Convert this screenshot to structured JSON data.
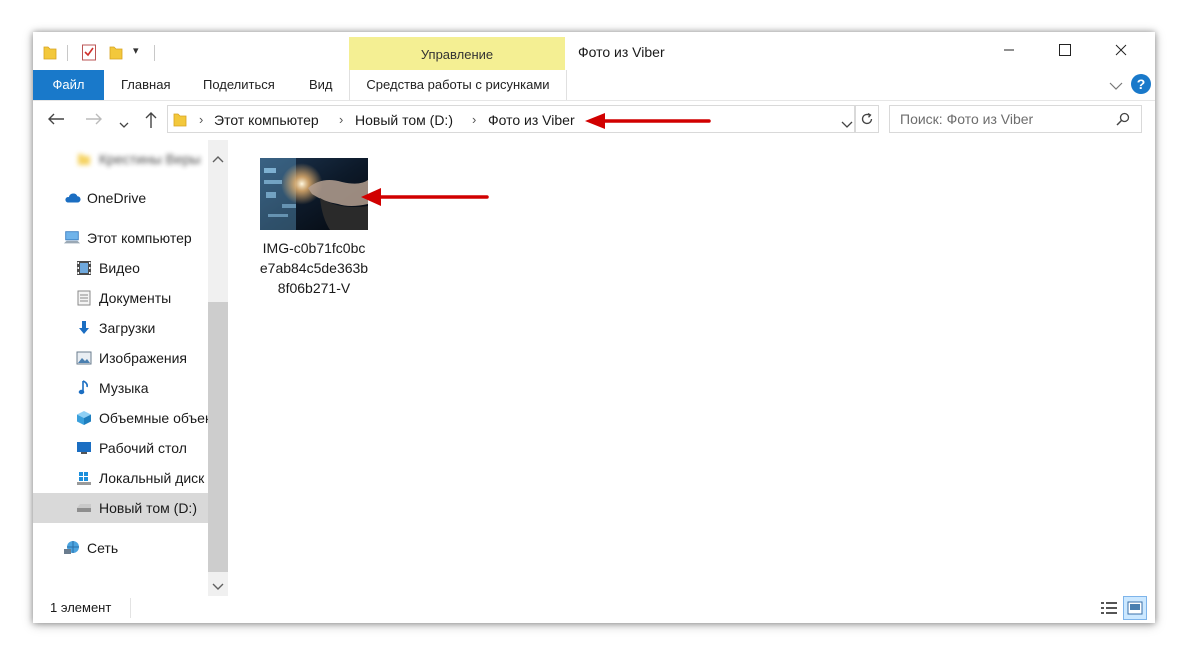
{
  "titlebar": {
    "title": "Фото из Viber",
    "context_tab_label": "Управление"
  },
  "ribbon": {
    "file_tab": "Файл",
    "tabs": [
      "Главная",
      "Поделиться",
      "Вид"
    ],
    "context_sub_tab": "Средства работы с рисунками"
  },
  "addressbar": {
    "crumbs": [
      "Этот компьютер",
      "Новый том (D:)",
      "Фото из Viber"
    ]
  },
  "search": {
    "placeholder": "Поиск: Фото из Viber"
  },
  "sidebar": {
    "items": [
      {
        "label": "Крестины Веры",
        "icon": "folder-icon"
      },
      {
        "label": "OneDrive",
        "icon": "onedrive-cloud-icon"
      },
      {
        "label": "Этот компьютер",
        "icon": "computer-icon"
      },
      {
        "label": "Видео",
        "icon": "video-icon"
      },
      {
        "label": "Документы",
        "icon": "documents-icon"
      },
      {
        "label": "Загрузки",
        "icon": "download-icon"
      },
      {
        "label": "Изображения",
        "icon": "pictures-icon"
      },
      {
        "label": "Музыка",
        "icon": "music-icon"
      },
      {
        "label": "Объемные объекты",
        "icon": "3d-objects-icon"
      },
      {
        "label": "Рабочий стол",
        "icon": "desktop-icon"
      },
      {
        "label": "Локальный диск (C:)",
        "icon": "windows-drive-icon"
      },
      {
        "label": "Новый том (D:)",
        "icon": "drive-icon"
      },
      {
        "label": "Сеть",
        "icon": "network-icon"
      }
    ]
  },
  "content": {
    "file": {
      "name_line1": "IMG-c0b71fc0bc",
      "name_line2": "e7ab84c5de363b",
      "name_line3": "8f06b271-V"
    }
  },
  "status": {
    "text": "1 элемент"
  },
  "colors": {
    "accent": "#1979ca",
    "context_tab": "#f4ef93",
    "arrow": "#d10000",
    "help": "#1979ca"
  }
}
